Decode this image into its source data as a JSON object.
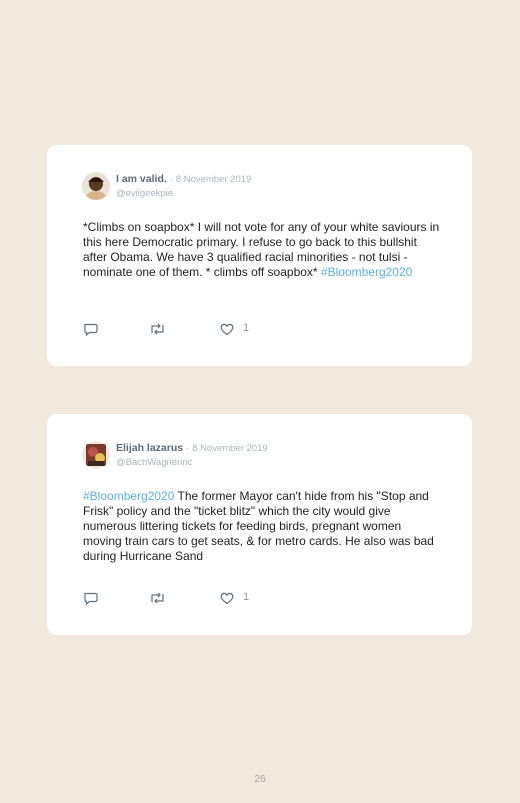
{
  "tweets": [
    {
      "name": "I am valid.",
      "separator": "·",
      "date": "8 November 2019",
      "handle": "@evilgeekpie",
      "text_before": "*Climbs on soapbox* I will not vote for any of your white saviours in this here Democratic primary. I refuse to go back to this bullshit after Obama. We have 3 qualified racial minorities - not tulsi - nominate one of them. * climbs off soapbox* ",
      "hashtag": "#Bloomberg2020",
      "text_after": "",
      "likes": "1",
      "icons": [
        "reply-icon",
        "retweet-icon",
        "heart-icon"
      ]
    },
    {
      "name": "Elijah lazarus",
      "separator": "·",
      "date": "8 November 2019",
      "handle": "@BachWagnerinc",
      "text_before": "",
      "hashtag": "#Bloomberg2020",
      "text_after": " The former Mayor can't hide from his \"Stop and Frisk\" policy and the \"ticket blitz\" which the city would give numerous littering tickets for feeding birds, pregnant women moving train cars to get seats, & for metro cards. He also was bad during Hurricane Sand",
      "likes": "1",
      "icons": [
        "reply-icon",
        "retweet-icon",
        "heart-icon"
      ]
    }
  ],
  "page_number": "26",
  "colors": {
    "background": "#f1e8de",
    "card": "#ffffff",
    "hashtag": "#58b1e3",
    "meta": "#aab4bd",
    "name": "#5b6b78"
  }
}
